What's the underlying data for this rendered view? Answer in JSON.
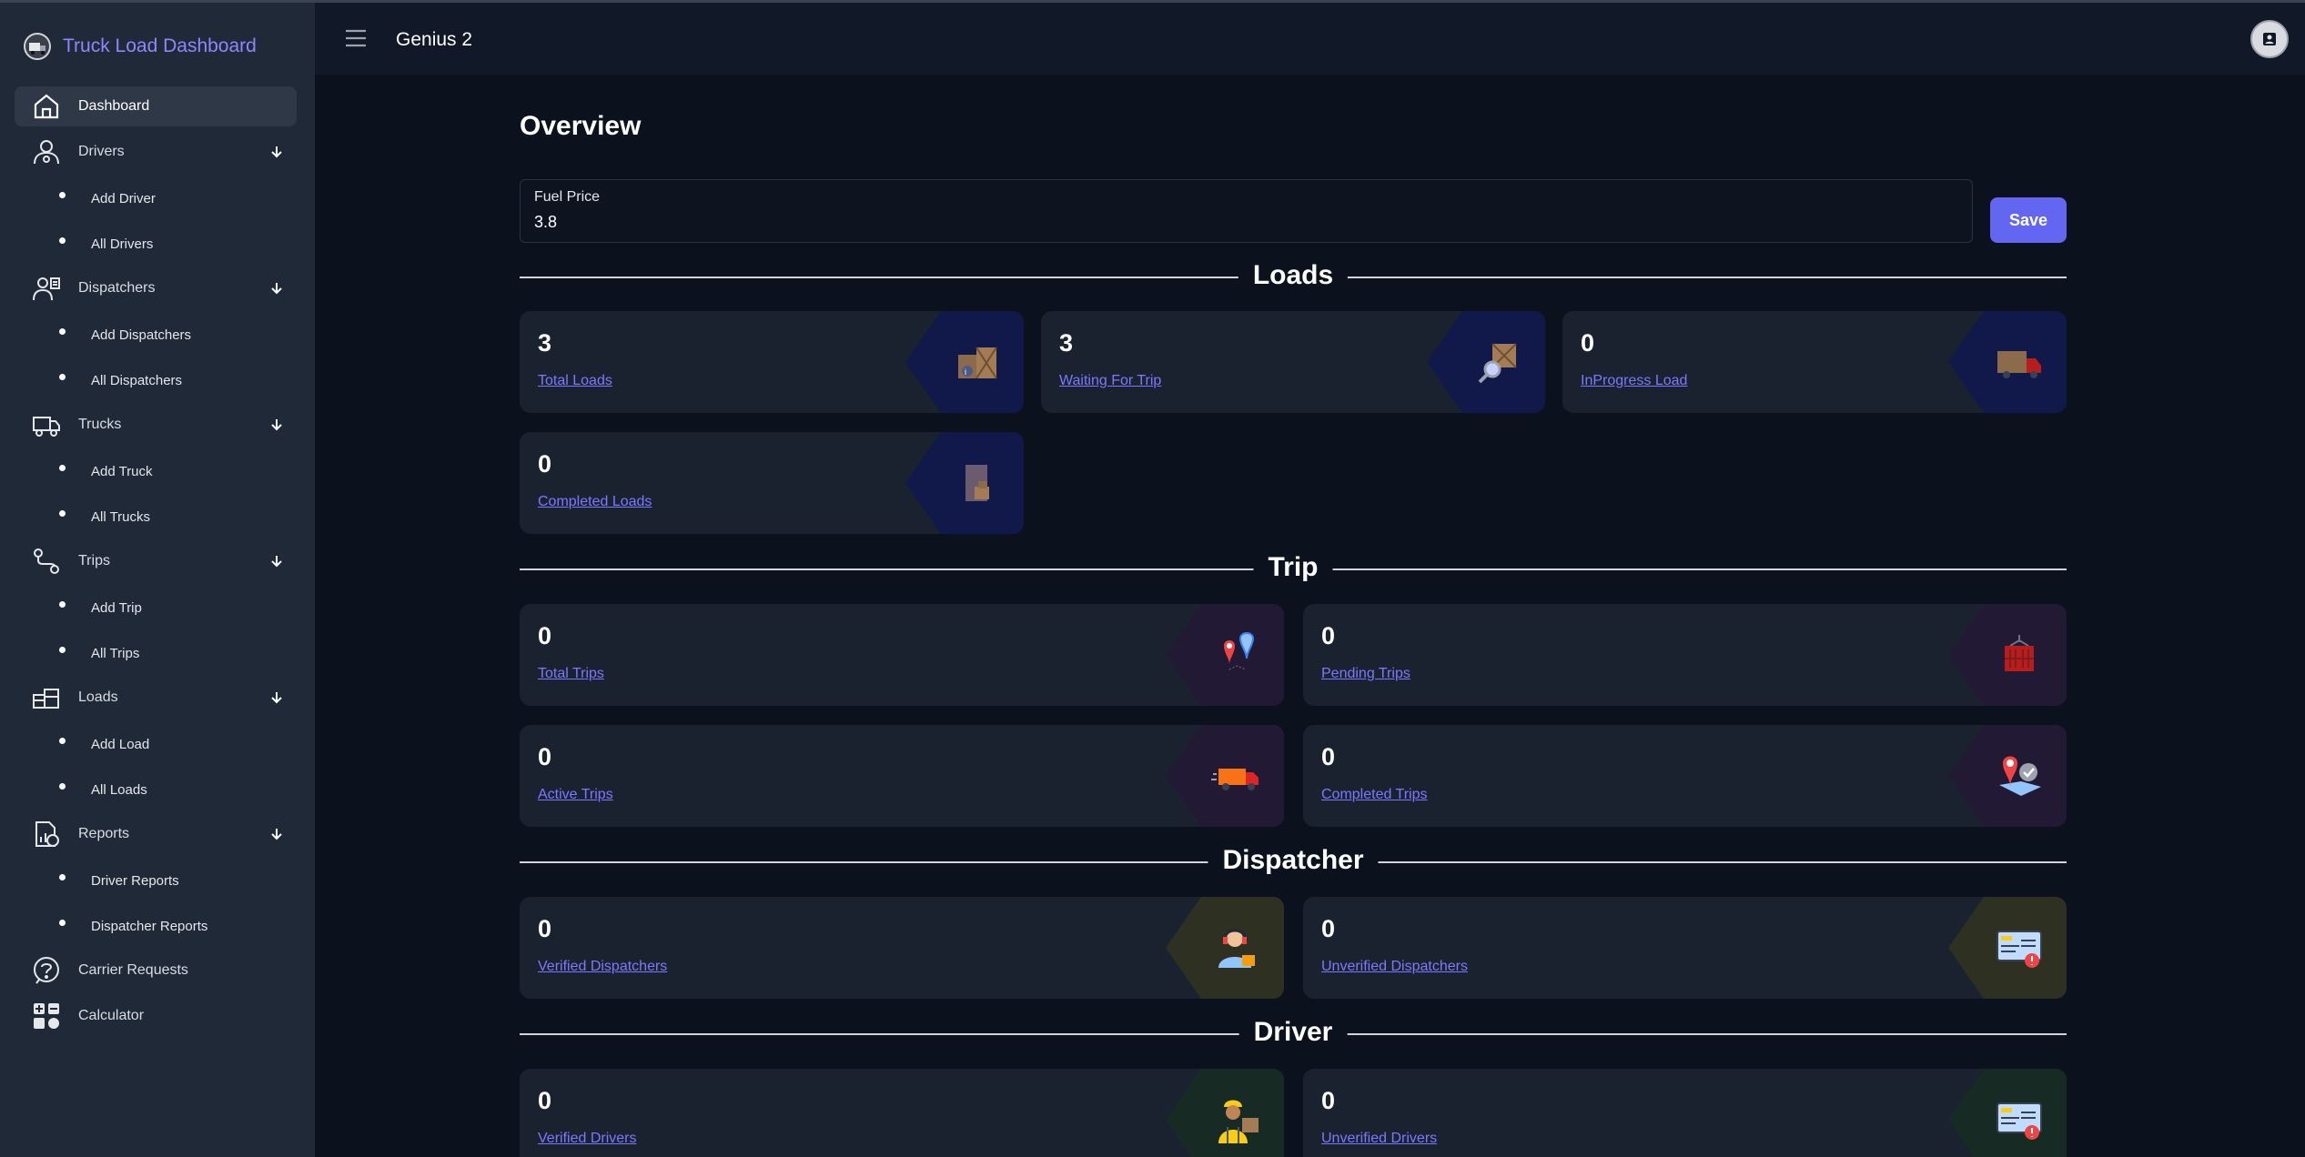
{
  "sidebar": {
    "brand": "Truck Load Dashboard",
    "items": [
      {
        "label": "Dashboard",
        "icon": "home-icon"
      },
      {
        "label": "Drivers",
        "icon": "driver-icon",
        "subitems": [
          "Add Driver",
          "All Drivers"
        ]
      },
      {
        "label": "Dispatchers",
        "icon": "dispatcher-icon",
        "subitems": [
          "Add Dispatchers",
          "All Dispatchers"
        ]
      },
      {
        "label": "Trucks",
        "icon": "truck-icon",
        "subitems": [
          "Add Truck",
          "All Trucks"
        ]
      },
      {
        "label": "Trips",
        "icon": "route-icon",
        "subitems": [
          "Add Trip",
          "All Trips"
        ]
      },
      {
        "label": "Loads",
        "icon": "loads-icon",
        "subitems": [
          "Add Load",
          "All Loads"
        ]
      },
      {
        "label": "Reports",
        "icon": "reports-icon",
        "subitems": [
          "Driver Reports",
          "Dispatcher Reports"
        ]
      },
      {
        "label": "Carrier Requests",
        "icon": "help-icon"
      },
      {
        "label": "Calculator",
        "icon": "calculator-icon"
      }
    ]
  },
  "topbar": {
    "title": "Genius 2"
  },
  "main": {
    "title": "Overview",
    "fuel": {
      "label": "Fuel Price",
      "value": "3.8"
    },
    "save_label": "Save",
    "sections": {
      "loads": {
        "title": "Loads",
        "cards": [
          {
            "value": "3",
            "label": "Total Loads",
            "icon": "boxes-icon"
          },
          {
            "value": "3",
            "label": "Waiting For Trip",
            "icon": "search-box-icon"
          },
          {
            "value": "0",
            "label": "InProgress Load",
            "icon": "delivery-truck-icon"
          },
          {
            "value": "0",
            "label": "Completed Loads",
            "icon": "package-door-icon"
          }
        ]
      },
      "trip": {
        "title": "Trip",
        "cards": [
          {
            "value": "0",
            "label": "Total Trips",
            "icon": "map-pins-icon"
          },
          {
            "value": "0",
            "label": "Pending Trips",
            "icon": "container-icon"
          },
          {
            "value": "0",
            "label": "Active Trips",
            "icon": "moving-truck-icon"
          },
          {
            "value": "0",
            "label": "Completed Trips",
            "icon": "location-check-icon"
          }
        ]
      },
      "dispatcher": {
        "title": "Dispatcher",
        "cards": [
          {
            "value": "0",
            "label": "Verified Dispatchers",
            "icon": "headset-person-icon"
          },
          {
            "value": "0",
            "label": "Unverified Dispatchers",
            "icon": "id-card-alert-icon"
          }
        ]
      },
      "driver": {
        "title": "Driver",
        "cards": [
          {
            "value": "0",
            "label": "Verified Drivers",
            "icon": "worker-icon"
          },
          {
            "value": "0",
            "label": "Unverified Drivers",
            "icon": "id-card-alert-icon"
          }
        ]
      }
    }
  },
  "colors": {
    "accent": "#6366f1",
    "link": "#7b79ff",
    "sidebar": "#1f2937",
    "background": "#0b111d"
  }
}
